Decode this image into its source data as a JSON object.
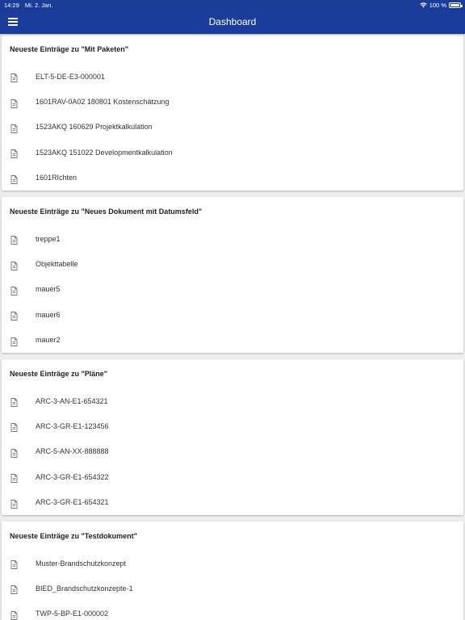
{
  "status": {
    "time": "14:29",
    "date": "Mi. 2. Jan.",
    "battery": "100 %",
    "battery_level": 1.0
  },
  "app": {
    "title": "Dashboard",
    "menu_icon": "hamburger-menu-icon"
  },
  "sections": [
    {
      "title": "Neueste Einträge zu \"Mit Paketen\"",
      "items": [
        "ELT-5-DE-E3-000001",
        "1601RAV-0A02 180801 Kostenschätzung",
        "1523AKQ 160629 Projektkalkulation",
        "1523AKQ 151022 Developmentkalkulation",
        "1601RIchten"
      ]
    },
    {
      "title": "Neueste Einträge zu \"Neues Dokument mit Datumsfeld\"",
      "items": [
        "treppe1",
        "Objekttabelle",
        "mauer5",
        "mauer6",
        "mauer2"
      ]
    },
    {
      "title": "Neueste Einträge zu \"Pläne\"",
      "items": [
        "ARC-3-AN-E1-654321",
        "ARC-3-GR-E1-123456",
        "ARC-5-AN-XX-888888",
        "ARC-3-GR-E1-654322",
        "ARC-3-GR-E1-654321"
      ]
    },
    {
      "title": "Neueste Einträge zu \"Testdokument\"",
      "items": [
        "Muster-Brandschutzkonzept",
        "BIED_Brandschutzkonzepte-1",
        "TWP-5-BP-E1-000002"
      ]
    }
  ],
  "colors": {
    "app_bar": "#1a3d99",
    "background": "#eeeeee",
    "icon": "#757575"
  },
  "icons": {
    "document": "document-icon",
    "wifi": "wifi-icon",
    "battery": "battery-icon"
  }
}
